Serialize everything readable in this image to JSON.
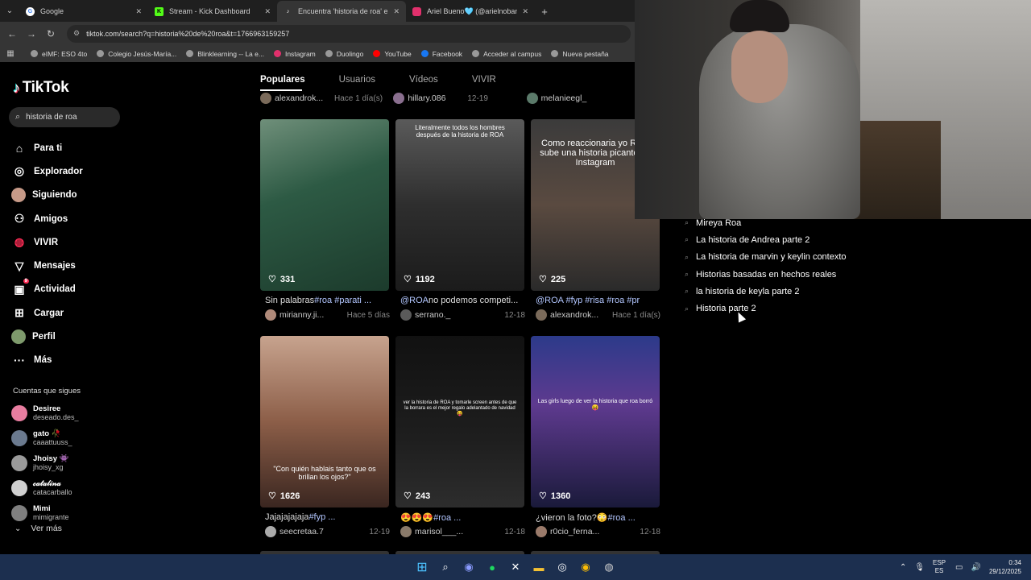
{
  "browser": {
    "tabs": [
      {
        "title": "Google",
        "favicon_color": "#4285f4",
        "active": false
      },
      {
        "title": "Stream - Kick Dashboard",
        "favicon_color": "#53fc18",
        "active": false
      },
      {
        "title": "Encuentra 'historia de roa' en T",
        "favicon_color": "#000000",
        "active": true
      },
      {
        "title": "Ariel Bueno🩵 (@arielnoban) -",
        "favicon_color": "#e1306c",
        "active": false
      }
    ],
    "url": "tiktok.com/search?q=historia%20de%20roa&t=1766963159257",
    "bookmarks": [
      {
        "label": "eIMF: ESO 4to",
        "color": "#999999"
      },
      {
        "label": "Colegio Jesús-María...",
        "color": "#999999"
      },
      {
        "label": "Blinklearning -- La e...",
        "color": "#999999"
      },
      {
        "label": "Instagram",
        "color": "#e1306c"
      },
      {
        "label": "Duolingo",
        "color": "#999999"
      },
      {
        "label": "YouTube",
        "color": "#ff0000"
      },
      {
        "label": "Facebook",
        "color": "#1877f2"
      },
      {
        "label": "Acceder al campus",
        "color": "#999999"
      },
      {
        "label": "Nueva pestaña",
        "color": "#999999"
      }
    ]
  },
  "tiktok": {
    "logo": "TikTok",
    "search_value": "historia de roa",
    "menu": [
      {
        "label": "Para ti",
        "icon": "home-icon"
      },
      {
        "label": "Explorador",
        "icon": "compass-icon"
      },
      {
        "label": "Siguiendo",
        "icon": "avatar-icon"
      },
      {
        "label": "Amigos",
        "icon": "friends-icon"
      },
      {
        "label": "VIVIR",
        "icon": "live-icon"
      },
      {
        "label": "Mensajes",
        "icon": "send-icon"
      },
      {
        "label": "Actividad",
        "icon": "activity-icon",
        "badge": "9"
      },
      {
        "label": "Cargar",
        "icon": "upload-icon"
      },
      {
        "label": "Perfil",
        "icon": "profile-avatar-icon"
      },
      {
        "label": "Más",
        "icon": "more-icon"
      }
    ],
    "following_header": "Cuentas que sigues",
    "following": [
      {
        "name": "Desiree",
        "handle": "deseado.des_",
        "color": "#e87da0"
      },
      {
        "name": "gato 🥀",
        "handle": "caaattuuss_",
        "color": "#6b7a8f"
      },
      {
        "name": "Jhoisy 👾",
        "handle": "jhoisy_xg",
        "color": "#9a9a9a"
      },
      {
        "name": "𝒸𝒶𝓉𝒶𝓁𝒾𝓃𝒶",
        "handle": "catacarballo",
        "color": "#cfcfcf"
      },
      {
        "name": "Mimi",
        "handle": "mimigrante",
        "color": "#7f7f7f"
      }
    ],
    "ver_mas": "Ver más",
    "tabs": [
      "Populares",
      "Usuarios",
      "Vídeos",
      "VIVIR"
    ],
    "top_meta": [
      {
        "user": "alexandrok...",
        "date": "Hace 1 día(s)"
      },
      {
        "user": "hillary.086",
        "date": "12-19"
      },
      {
        "user": "melanieegl_",
        "date": ""
      }
    ],
    "videos": [
      {
        "likes": "331",
        "caption": "Sin palabras",
        "tags": "#roa #parati ...",
        "user": "mirianny.ji...",
        "date": "Hace 5 días",
        "overlay": "",
        "bg": "linear-gradient(160deg,#6f8f7a,#2d5a44 40%,#1c3b2c)"
      },
      {
        "likes": "1192",
        "caption": "@ROA",
        "tags": "no podemos competi...",
        "user": "serrano._",
        "date": "12-18",
        "overlay": "Literalmente todos los hombres después de la historia de ROA",
        "bg": "linear-gradient(180deg,#5a5a5a,#2e2e2e 50%,#1b1b1b)"
      },
      {
        "likes": "225",
        "caption": "@ROA #fyp #risa #roa #pr",
        "tags": "",
        "user": "alexandrok...",
        "date": "Hace 1 día(s)",
        "overlay": "Como reaccionaria yo ROA sube una historia picante en Instagram",
        "bg": "linear-gradient(180deg,#3b3b3b,#5a4a40 50%,#2a2a2a)"
      },
      {
        "likes": "1626",
        "caption": "Jajajajajaja",
        "tags": "#fyp ...",
        "user": "seecretaa.7",
        "date": "12-19",
        "overlay": "\"Con quién hablais tanto que os brillan los ojos?\"",
        "bg": "linear-gradient(180deg,#c7a38e,#8c5e48 50%,#3a2620)"
      },
      {
        "likes": "243",
        "caption": "😍😍😍",
        "tags": "#roa ...",
        "user": "marisol___...",
        "date": "12-18",
        "overlay": "ver la historia de ROA y tomarle screen antes de que la borrara es el mejor regalo adelantado de navidad😝",
        "bg": "linear-gradient(180deg,#111,#1e1e1e 60%,#2d2d2d)"
      },
      {
        "likes": "1360",
        "caption": "¿vieron la foto?😳",
        "tags": "#roa ...",
        "user": "r0cio_ferna...",
        "date": "12-18",
        "overlay": "Las girls luego de ver la historia que roa borró😝",
        "bg": "linear-gradient(180deg,#2c3a8a,#5e3a8f 40%,#1a1a3a)"
      }
    ],
    "suggestions": [
      "Mireya Roa",
      "La historia de Andrea parte 2",
      "La historia de marvin y keylin contexto",
      "Historias basadas en hechos reales",
      "la historia de keyla parte 2",
      "Historia parte 2"
    ]
  },
  "taskbar": {
    "lang_top": "ESP",
    "lang_bottom": "ES",
    "time": "0:34",
    "date": "29/12/2025"
  }
}
